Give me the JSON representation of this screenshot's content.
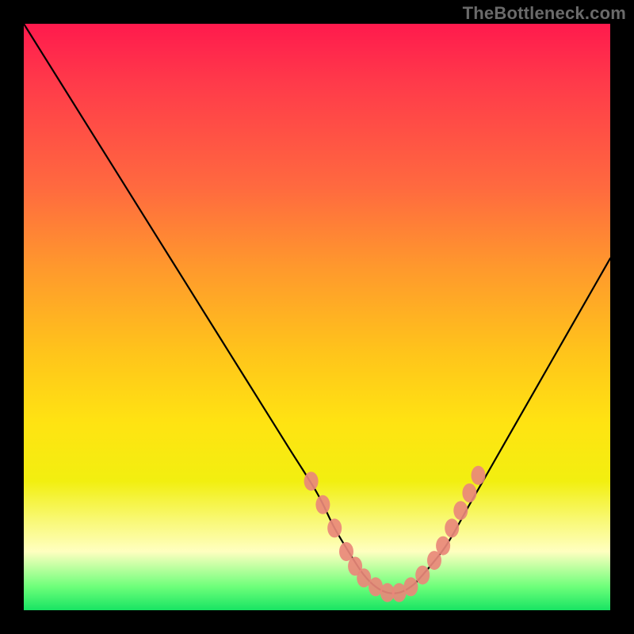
{
  "watermark": {
    "text": "TheBottleneck.com"
  },
  "chart_data": {
    "type": "line",
    "title": "",
    "xlabel": "",
    "ylabel": "",
    "xlim": [
      0,
      100
    ],
    "ylim": [
      0,
      100
    ],
    "series": [
      {
        "name": "bottleneck-curve",
        "x": [
          0,
          5,
          10,
          15,
          20,
          25,
          30,
          35,
          40,
          45,
          50,
          53,
          56,
          58,
          60,
          62,
          64,
          66,
          68,
          72,
          76,
          80,
          84,
          88,
          92,
          96,
          100
        ],
        "y": [
          100,
          92,
          84,
          76,
          68,
          60,
          52,
          44,
          36,
          28,
          20,
          14,
          9,
          6,
          4,
          3,
          3,
          4,
          6,
          11,
          18,
          25,
          32,
          39,
          46,
          53,
          60
        ]
      }
    ],
    "markers": [
      {
        "name": "highlight-dots",
        "color": "#e98879",
        "points": [
          {
            "x": 49,
            "y": 22
          },
          {
            "x": 51,
            "y": 18
          },
          {
            "x": 53,
            "y": 14
          },
          {
            "x": 55,
            "y": 10
          },
          {
            "x": 56.5,
            "y": 7.5
          },
          {
            "x": 58,
            "y": 5.5
          },
          {
            "x": 60,
            "y": 4
          },
          {
            "x": 62,
            "y": 3
          },
          {
            "x": 64,
            "y": 3
          },
          {
            "x": 66,
            "y": 4
          },
          {
            "x": 68,
            "y": 6
          },
          {
            "x": 70,
            "y": 8.5
          },
          {
            "x": 71.5,
            "y": 11
          },
          {
            "x": 73,
            "y": 14
          },
          {
            "x": 74.5,
            "y": 17
          },
          {
            "x": 76,
            "y": 20
          },
          {
            "x": 77.5,
            "y": 23
          }
        ]
      }
    ],
    "legend": false,
    "grid": false
  }
}
